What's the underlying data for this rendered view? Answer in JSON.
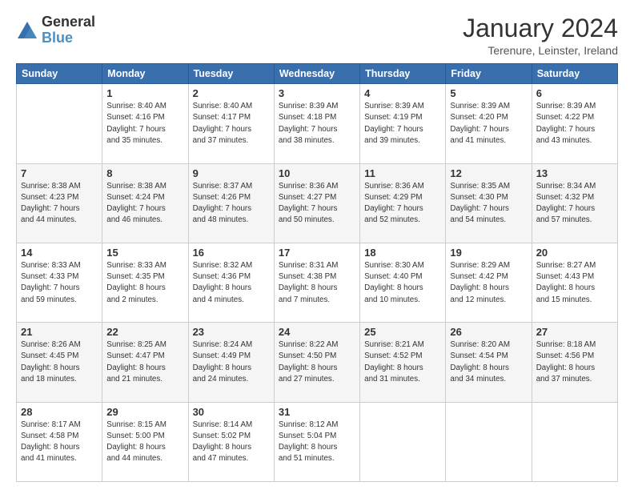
{
  "header": {
    "logo_general": "General",
    "logo_blue": "Blue",
    "month_title": "January 2024",
    "location": "Terenure, Leinster, Ireland"
  },
  "weekdays": [
    "Sunday",
    "Monday",
    "Tuesday",
    "Wednesday",
    "Thursday",
    "Friday",
    "Saturday"
  ],
  "weeks": [
    [
      {
        "day": "",
        "info": ""
      },
      {
        "day": "1",
        "info": "Sunrise: 8:40 AM\nSunset: 4:16 PM\nDaylight: 7 hours\nand 35 minutes."
      },
      {
        "day": "2",
        "info": "Sunrise: 8:40 AM\nSunset: 4:17 PM\nDaylight: 7 hours\nand 37 minutes."
      },
      {
        "day": "3",
        "info": "Sunrise: 8:39 AM\nSunset: 4:18 PM\nDaylight: 7 hours\nand 38 minutes."
      },
      {
        "day": "4",
        "info": "Sunrise: 8:39 AM\nSunset: 4:19 PM\nDaylight: 7 hours\nand 39 minutes."
      },
      {
        "day": "5",
        "info": "Sunrise: 8:39 AM\nSunset: 4:20 PM\nDaylight: 7 hours\nand 41 minutes."
      },
      {
        "day": "6",
        "info": "Sunrise: 8:39 AM\nSunset: 4:22 PM\nDaylight: 7 hours\nand 43 minutes."
      }
    ],
    [
      {
        "day": "7",
        "info": "Sunrise: 8:38 AM\nSunset: 4:23 PM\nDaylight: 7 hours\nand 44 minutes."
      },
      {
        "day": "8",
        "info": "Sunrise: 8:38 AM\nSunset: 4:24 PM\nDaylight: 7 hours\nand 46 minutes."
      },
      {
        "day": "9",
        "info": "Sunrise: 8:37 AM\nSunset: 4:26 PM\nDaylight: 7 hours\nand 48 minutes."
      },
      {
        "day": "10",
        "info": "Sunrise: 8:36 AM\nSunset: 4:27 PM\nDaylight: 7 hours\nand 50 minutes."
      },
      {
        "day": "11",
        "info": "Sunrise: 8:36 AM\nSunset: 4:29 PM\nDaylight: 7 hours\nand 52 minutes."
      },
      {
        "day": "12",
        "info": "Sunrise: 8:35 AM\nSunset: 4:30 PM\nDaylight: 7 hours\nand 54 minutes."
      },
      {
        "day": "13",
        "info": "Sunrise: 8:34 AM\nSunset: 4:32 PM\nDaylight: 7 hours\nand 57 minutes."
      }
    ],
    [
      {
        "day": "14",
        "info": "Sunrise: 8:33 AM\nSunset: 4:33 PM\nDaylight: 7 hours\nand 59 minutes."
      },
      {
        "day": "15",
        "info": "Sunrise: 8:33 AM\nSunset: 4:35 PM\nDaylight: 8 hours\nand 2 minutes."
      },
      {
        "day": "16",
        "info": "Sunrise: 8:32 AM\nSunset: 4:36 PM\nDaylight: 8 hours\nand 4 minutes."
      },
      {
        "day": "17",
        "info": "Sunrise: 8:31 AM\nSunset: 4:38 PM\nDaylight: 8 hours\nand 7 minutes."
      },
      {
        "day": "18",
        "info": "Sunrise: 8:30 AM\nSunset: 4:40 PM\nDaylight: 8 hours\nand 10 minutes."
      },
      {
        "day": "19",
        "info": "Sunrise: 8:29 AM\nSunset: 4:42 PM\nDaylight: 8 hours\nand 12 minutes."
      },
      {
        "day": "20",
        "info": "Sunrise: 8:27 AM\nSunset: 4:43 PM\nDaylight: 8 hours\nand 15 minutes."
      }
    ],
    [
      {
        "day": "21",
        "info": "Sunrise: 8:26 AM\nSunset: 4:45 PM\nDaylight: 8 hours\nand 18 minutes."
      },
      {
        "day": "22",
        "info": "Sunrise: 8:25 AM\nSunset: 4:47 PM\nDaylight: 8 hours\nand 21 minutes."
      },
      {
        "day": "23",
        "info": "Sunrise: 8:24 AM\nSunset: 4:49 PM\nDaylight: 8 hours\nand 24 minutes."
      },
      {
        "day": "24",
        "info": "Sunrise: 8:22 AM\nSunset: 4:50 PM\nDaylight: 8 hours\nand 27 minutes."
      },
      {
        "day": "25",
        "info": "Sunrise: 8:21 AM\nSunset: 4:52 PM\nDaylight: 8 hours\nand 31 minutes."
      },
      {
        "day": "26",
        "info": "Sunrise: 8:20 AM\nSunset: 4:54 PM\nDaylight: 8 hours\nand 34 minutes."
      },
      {
        "day": "27",
        "info": "Sunrise: 8:18 AM\nSunset: 4:56 PM\nDaylight: 8 hours\nand 37 minutes."
      }
    ],
    [
      {
        "day": "28",
        "info": "Sunrise: 8:17 AM\nSunset: 4:58 PM\nDaylight: 8 hours\nand 41 minutes."
      },
      {
        "day": "29",
        "info": "Sunrise: 8:15 AM\nSunset: 5:00 PM\nDaylight: 8 hours\nand 44 minutes."
      },
      {
        "day": "30",
        "info": "Sunrise: 8:14 AM\nSunset: 5:02 PM\nDaylight: 8 hours\nand 47 minutes."
      },
      {
        "day": "31",
        "info": "Sunrise: 8:12 AM\nSunset: 5:04 PM\nDaylight: 8 hours\nand 51 minutes."
      },
      {
        "day": "",
        "info": ""
      },
      {
        "day": "",
        "info": ""
      },
      {
        "day": "",
        "info": ""
      }
    ]
  ]
}
